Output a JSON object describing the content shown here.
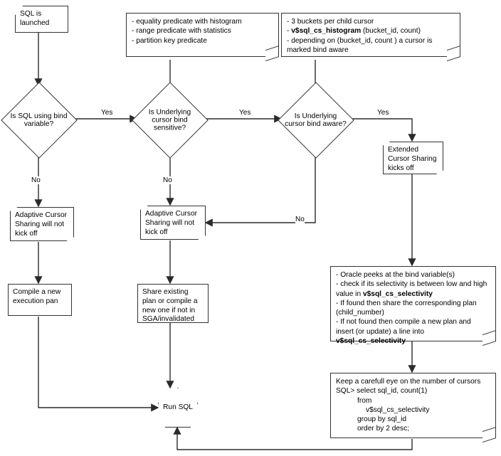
{
  "nodes": {
    "start": "SQL is launched",
    "dec_bindvar": "Is SQL using bind variable?",
    "dec_sensitive": "Is Underlying cursor bind sensitive?",
    "dec_aware": "Is Underlying cursor bind aware?",
    "note_sensitive_l1": "- equality predicate with histogram",
    "note_sensitive_l2": "- range predicate with statistics",
    "note_sensitive_l3": "- partition key predicate",
    "note_aware_l1": "- 3 buckets per child cursor",
    "note_aware_l2a": "- ",
    "note_aware_l2b": "v$sql_cs_histogram",
    "note_aware_l2c": " (bucket_id, count)",
    "note_aware_l3": "- depending on (bucket_id, count ) a cursor is marked bind aware",
    "ecs": "Extended Cursor Sharing kicks off",
    "acs_no1": "Adaptive Cursor Sharing will not kick off",
    "acs_no2": "Adaptive Cursor Sharing will not kick off",
    "compile_new": "Compile a new execution pan",
    "share_plan": "Share existing plan or compile a new one if not in SGA/invalidated",
    "note_peek_l1": "- Oracle peeks at the bind variable(s)",
    "note_peek_l2a": "- check if its selectivity is between low and high value in ",
    "note_peek_l2b": "v$sql_cs_selectivity",
    "note_peek_l3": "- If found then share the corresponding plan (child_number)",
    "note_peek_l4a": "- If not found then compile a new plan and insert (or update) a line into ",
    "note_peek_l4b": "v$sql_cs_selectivity",
    "note_cursors_l1": "Keep a carefull eye on the number of cursors",
    "note_cursors_l2": "SQL> select sql_id, count(1)",
    "note_cursors_l3": "from",
    "note_cursors_l4": "v$sql_cs_selectivity",
    "note_cursors_l5": "group by sql_id",
    "note_cursors_l6": "order by 2 desc;",
    "run": "Run SQL"
  },
  "edges": {
    "yes": "Yes",
    "no": "No"
  }
}
